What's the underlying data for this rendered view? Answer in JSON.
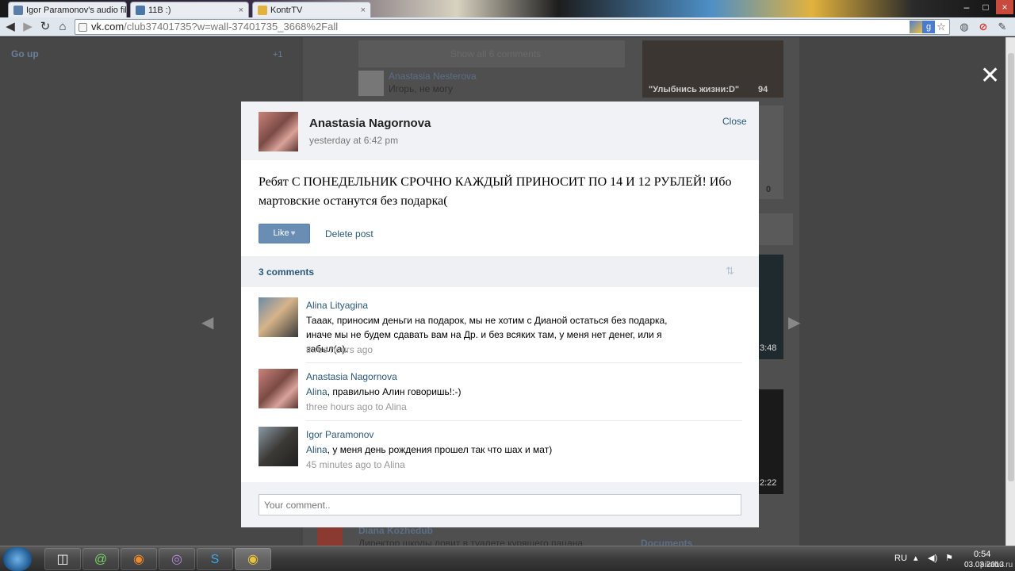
{
  "browser": {
    "tabs": [
      {
        "label": "Igor Paramonov's audio file",
        "close": "×"
      },
      {
        "label": "11В :)",
        "close": "×"
      },
      {
        "label": "KontrTV",
        "close": "×"
      }
    ],
    "url_host": "vk.com",
    "url_path": "/club37401735?w=wall-37401735_3668%2Fall",
    "window_controls": [
      "–",
      "□",
      "×"
    ]
  },
  "background": {
    "go_up": "Go up",
    "go_up_count": "+1",
    "show_all": "Show all 6 comments",
    "bg_commenter": "Anastasia Nesterova",
    "bg_comment": "Игорь, не могу",
    "album_title": "\"Улыбнись жизни:D\"",
    "album_count": "94",
    "album_count2": "0",
    "video_time1": "3:48",
    "video_time2": "2:22",
    "bg_author": "Diana Kozhedub",
    "bg_post": "Директор школы ловит в туалете курящего пацана.",
    "documents": "Documents"
  },
  "modal": {
    "author": "Anastasia Nagornova",
    "time": "yesterday at 6:42 pm",
    "close_label": "Close",
    "post_text": "Ребят С ПОНЕДЕЛЬНИК СРОЧНО КАЖДЫЙ ПРИНОСИТ ПО 14 И 12 РУБЛЕЙ! Ибо мартовские останутся без подарка(",
    "like_label": "Like",
    "delete_label": "Delete post",
    "comments_count": "3 comments",
    "comments": [
      {
        "name": "Alina Lityagina",
        "text": "Тааак, приносим деньги на подарок, мы не хотим с Дианой остаться без подарка, иначе мы не будем сдавать вам на Др. и без всяких там, у меня нет денег, или я забыл(а).",
        "meta": "three hours ago"
      },
      {
        "name": "Anastasia Nagornova",
        "mention": "Alina",
        "text": ", правильно Алин говоришь!:-)",
        "meta": "three hours ago to Alina"
      },
      {
        "name": "Igor Paramonov",
        "mention": "Alina",
        "text": ", у меня день рождения прошел так что шах и мат)",
        "meta": "45 minutes ago to Alina"
      }
    ],
    "reply_placeholder": "Your comment.."
  },
  "taskbar": {
    "lang": "RU",
    "time": "0:54",
    "date": "03.03.2013",
    "watermark": "pikabu.ru"
  },
  "colors": {
    "link": "#2b587a",
    "like_button": "#6a8db4",
    "overlay": "#454545"
  }
}
